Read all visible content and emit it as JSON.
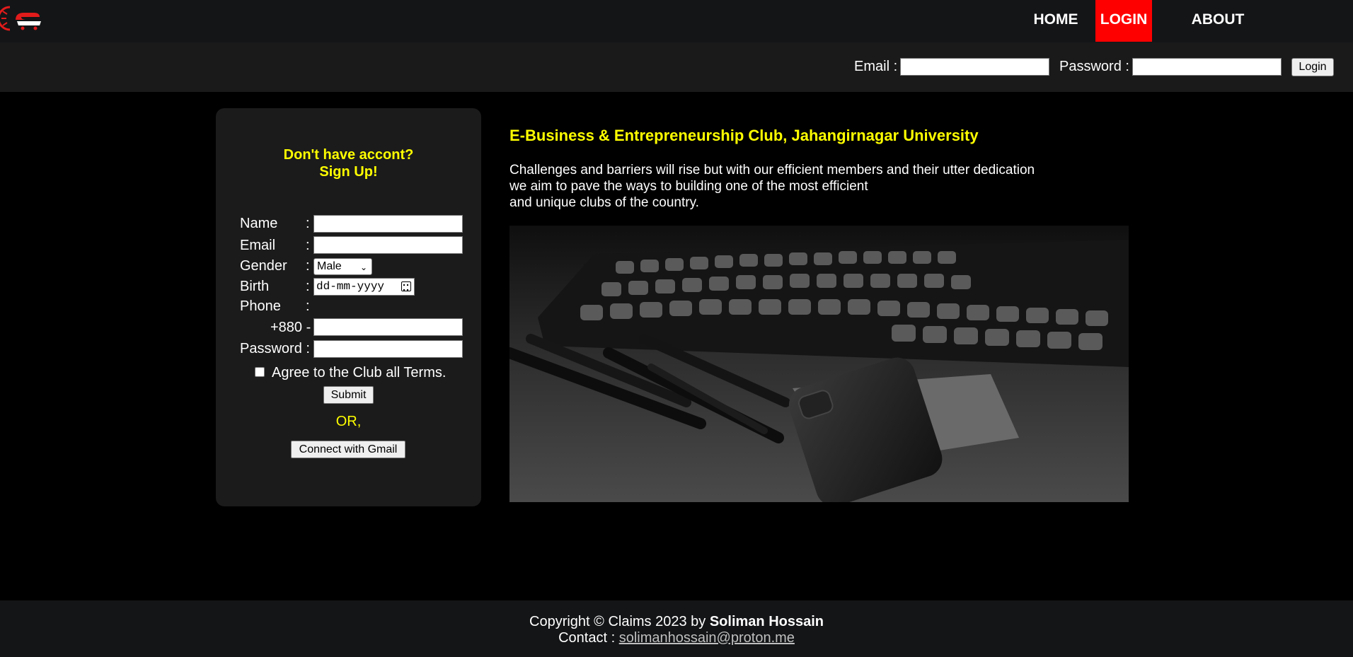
{
  "nav": {
    "items": [
      {
        "label": "HOME"
      },
      {
        "label": "LOGIN"
      },
      {
        "label": "ABOUT"
      }
    ],
    "active_color": "#ff0000"
  },
  "login_bar": {
    "email_label": "Email :",
    "email_value": "",
    "password_label": "Password :",
    "password_value": "",
    "button_label": "Login"
  },
  "signup": {
    "title_line1": "Don't have accont?",
    "title_line2": "Sign Up!",
    "fields": {
      "name_label": "Name",
      "email_label": "Email",
      "gender_label": "Gender",
      "gender_value": "Male",
      "birth_label": "Birth",
      "birth_placeholder": "dd-mm-yyyy",
      "phone_label": "Phone",
      "phone_prefix": "+880 -",
      "password_label": "Password :",
      "colon": ":"
    },
    "terms_label": "Agree to the Club all Terms.",
    "submit_label": "Submit",
    "or_text": "OR,",
    "gmail_label": "Connect with Gmail"
  },
  "content": {
    "heading": "E-Business & Entrepreneurship Club, Jahangirnagar University",
    "paragraph_lines": [
      "Challenges and barriers will rise but with our efficient members and their utter dedication",
      "we aim to pave the ways to building one of the most efficient",
      "and unique clubs of the country."
    ]
  },
  "footer": {
    "copyright_prefix": "Copyright © Claims 2023 by ",
    "author": "Soliman Hossain",
    "contact_prefix": "Contact : ",
    "contact_email": "solimanhossain@proton.me"
  },
  "colors": {
    "accent_yellow": "#ffff00",
    "accent_red": "#ff0000",
    "panel_bg": "#1b1b1b"
  }
}
